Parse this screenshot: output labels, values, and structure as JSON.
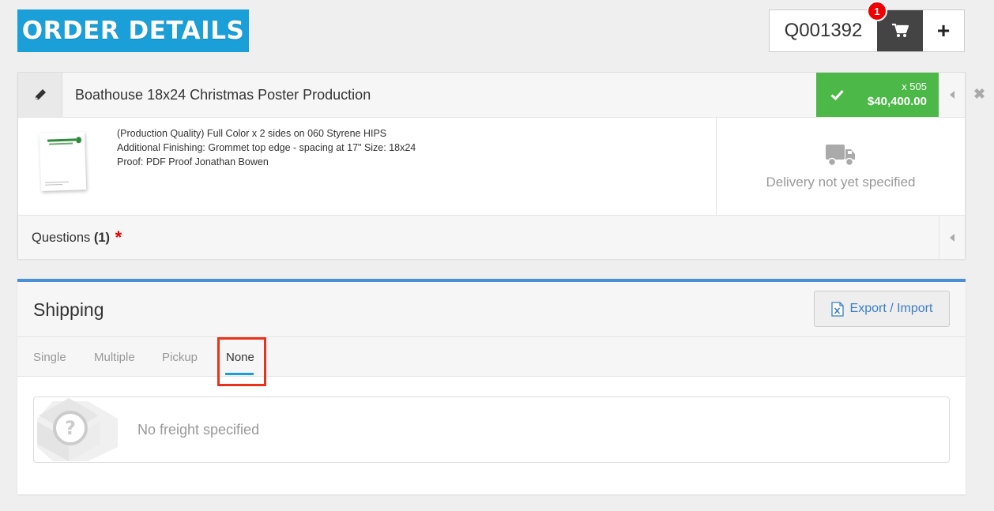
{
  "header": {
    "title": "ORDER DETAILS",
    "quote_number": "Q001392",
    "cart_count": "1",
    "add_label": "+"
  },
  "product": {
    "name": "Boathouse 18x24 Christmas Poster Production",
    "quantity": "x 505",
    "price": "$40,400.00",
    "description": [
      "(Production Quality) Full Color x 2 sides on 060 Styrene HIPS",
      "Additional Finishing: Grommet top edge - spacing at 17\" Size: 18x24",
      "Proof: PDF Proof Jonathan Bowen"
    ],
    "delivery_status": "Delivery not yet specified",
    "remove_label": "✖"
  },
  "questions": {
    "label": "Questions ",
    "count": "(1)",
    "required_mark": "*"
  },
  "shipping": {
    "title": "Shipping",
    "export_label": "Export / Import",
    "tabs": [
      {
        "label": "Single",
        "active": false
      },
      {
        "label": "Multiple",
        "active": false
      },
      {
        "label": "Pickup",
        "active": false
      },
      {
        "label": "None",
        "active": true
      }
    ],
    "freight_text": "No freight specified"
  },
  "colors": {
    "title_bg": "#1a9fd8",
    "price_bg": "#4cb848",
    "accent_border": "#4a90d9",
    "highlight": "#e8321a",
    "badge": "#ee0000"
  },
  "icons": [
    "pencil-icon",
    "cart-icon",
    "check-icon",
    "truck-icon",
    "excel-icon",
    "question-box-icon",
    "close-icon"
  ]
}
